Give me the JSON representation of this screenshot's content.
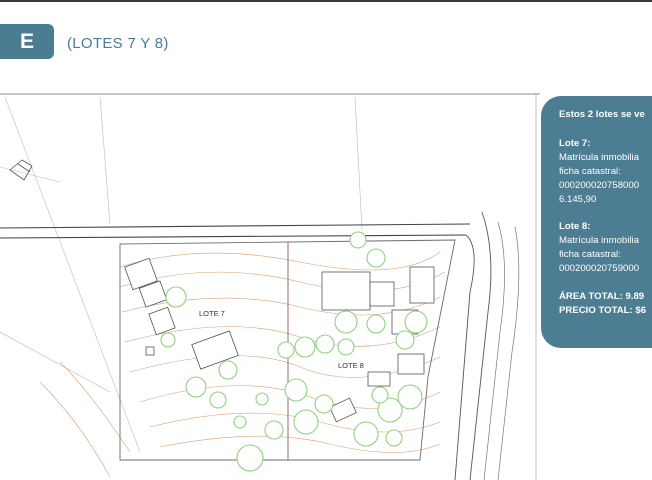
{
  "header": {
    "lote_tab": "E B",
    "subtitle": "(LOTES 7 Y 8)"
  },
  "plan": {
    "lot7_label": "LOTE 7",
    "lot8_label": "LOTE 8"
  },
  "info_card": {
    "intro": "Estos 2 lotes se ve",
    "lot7": {
      "title": "Lote 7:",
      "line1": "Matrícula inmobilia",
      "line2": "ficha catastral:",
      "line3": "000200020758000",
      "line4": "6.145,90"
    },
    "lot8": {
      "title": "Lote 8:",
      "line1": "Matrícula inmobilia",
      "line2": "ficha catastral:",
      "line3": "000200020759000"
    },
    "area_total": "ÁREA TOTAL: 9.89",
    "precio_total": "PRECIO TOTAL: $6"
  },
  "colors": {
    "accent": "#4a7c92",
    "card": "#4c7d93",
    "tree": "#8fd17a",
    "contour": "#d9a072",
    "boundary": "#c25a5a"
  }
}
